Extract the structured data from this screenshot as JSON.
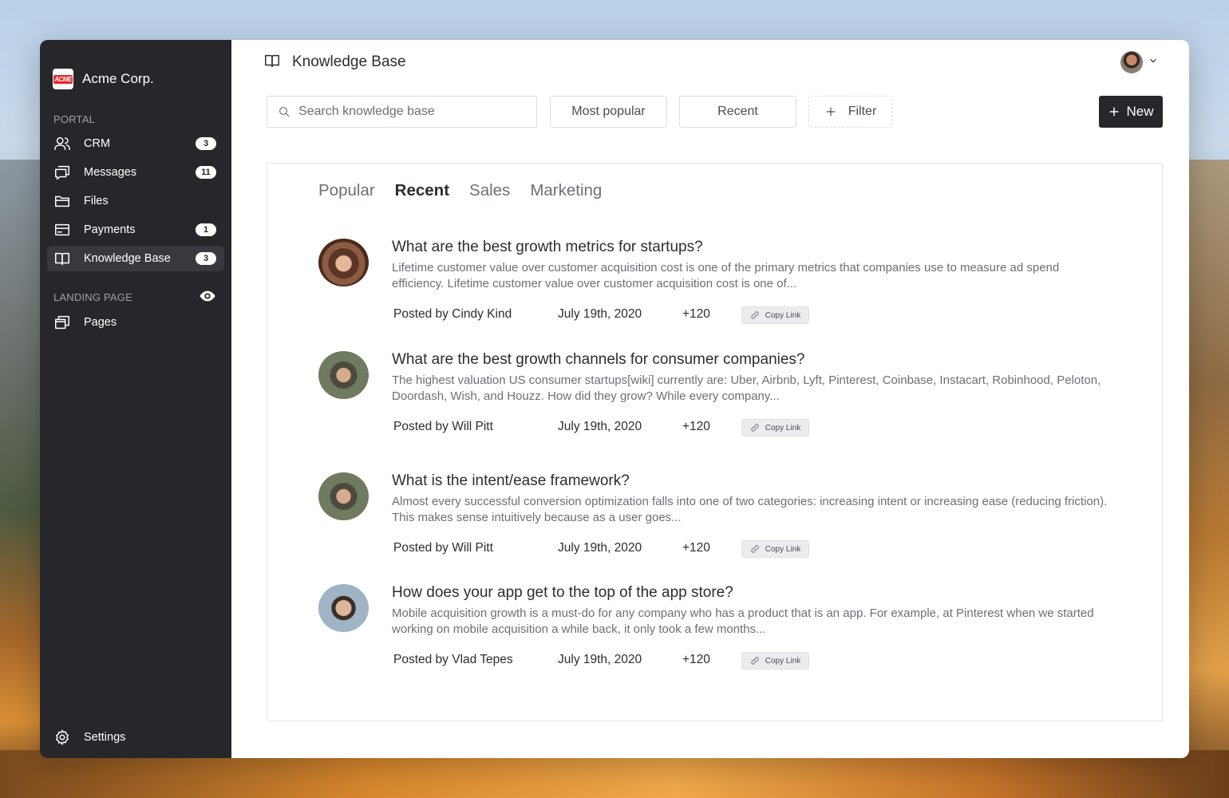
{
  "brand": {
    "name": "Acme Corp.",
    "logo_text": "ACME"
  },
  "sidebar": {
    "portal_label": "PORTAL",
    "items": [
      {
        "label": "CRM",
        "badge": "3",
        "icon": "users-icon"
      },
      {
        "label": "Messages",
        "badge": "11",
        "icon": "messages-icon"
      },
      {
        "label": "Files",
        "badge": "",
        "icon": "folder-icon"
      },
      {
        "label": "Payments",
        "badge": "1",
        "icon": "credit-card-icon"
      },
      {
        "label": "Knowledge Base",
        "badge": "3",
        "icon": "book-icon",
        "active": true
      }
    ],
    "landing_label": "LANDING PAGE",
    "landing_items": [
      {
        "label": "Pages",
        "icon": "pages-icon"
      }
    ],
    "settings_label": "Settings"
  },
  "header": {
    "title": "Knowledge Base"
  },
  "toolbar": {
    "search_placeholder": "Search knowledge base",
    "most_popular_label": "Most popular",
    "recent_label": "Recent",
    "filter_label": "Filter",
    "new_label": "New"
  },
  "tabs": [
    {
      "label": "Popular",
      "active": false
    },
    {
      "label": "Recent",
      "active": true
    },
    {
      "label": "Sales",
      "active": false
    },
    {
      "label": "Marketing",
      "active": false
    }
  ],
  "articles": [
    {
      "title": "What are the best growth metrics for startups?",
      "excerpt": "Lifetime customer value over customer acquisition cost is one of the primary metrics that companies use to measure ad spend efficiency. Lifetime customer value over customer acquisition cost is one of...",
      "posted_by_prefix": "Posted by",
      "author": "Cindy Kind",
      "date": "July 19th, 2020",
      "votes": "+120",
      "copy_link_label": "Copy Link"
    },
    {
      "title": "What are the best growth channels for consumer companies?",
      "excerpt": "The highest valuation US consumer startups[wiki] currently are: Uber, Airbnb, Lyft, Pinterest, Coinbase, Instacart, Robinhood, Peloton, Doordash, Wish, and Houzz. How did they grow? While every company...",
      "posted_by_prefix": "Posted by",
      "author": "Will Pitt",
      "date": "July 19th, 2020",
      "votes": "+120",
      "copy_link_label": "Copy Link"
    },
    {
      "title": "What is the intent/ease framework?",
      "excerpt": "Almost every successful conversion optimization falls into one of two categories: increasing intent or increasing ease (reducing friction). This makes sense intuitively because as a user goes...",
      "posted_by_prefix": "Posted by",
      "author": "Will Pitt",
      "date": "July 19th, 2020",
      "votes": "+120",
      "copy_link_label": "Copy Link"
    },
    {
      "title": "How does your app get to the top of the app store?",
      "excerpt": "Mobile acquisition growth is a must-do for any company who has a product that is an app. For example, at Pinterest when we started working on mobile acquisition a while back, it only took a few months...",
      "posted_by_prefix": "Posted by",
      "author": "Vlad Tepes",
      "date": "July 19th, 2020",
      "votes": "+120",
      "copy_link_label": "Copy Link"
    }
  ],
  "colors": {
    "sidebar_bg": "#26272b",
    "accent": "#26272b",
    "text": "#2b2d33",
    "muted": "#6b6f78"
  }
}
